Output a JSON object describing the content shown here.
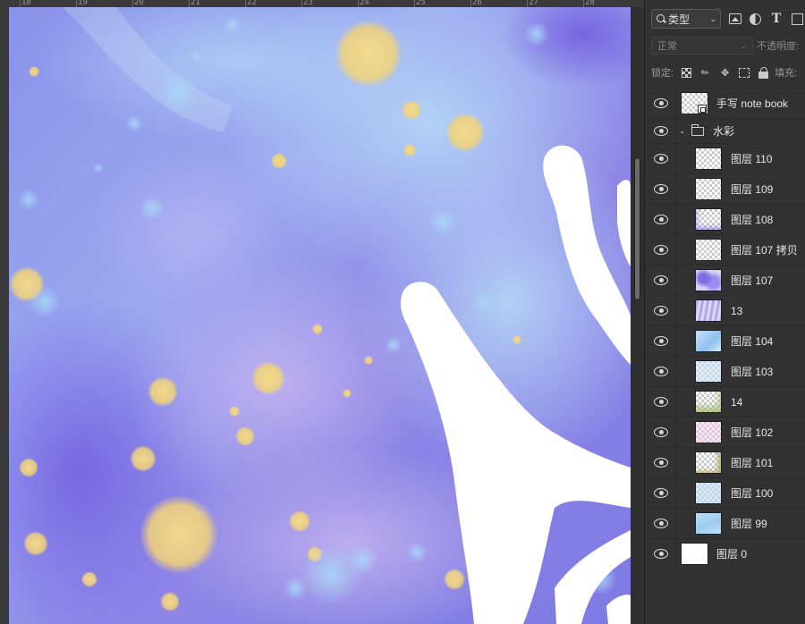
{
  "ruler": {
    "labels": [
      "18",
      "19",
      "20",
      "21",
      "22",
      "23",
      "24",
      "25",
      "26",
      "27",
      "28"
    ]
  },
  "layers_panel": {
    "filter": {
      "kind_label": "类型",
      "icons": [
        "image-filter-icon",
        "adjustment-filter-icon",
        "type-filter-icon",
        "shape-filter-icon"
      ]
    },
    "blend_mode": "正常",
    "opacity_label": "不透明度:",
    "lock_label": "锁定:",
    "fill_label": "填充:",
    "layers": [
      {
        "name": "手写 note book",
        "type": "smart-object",
        "visible": true
      },
      {
        "name": "水彩",
        "type": "group",
        "expanded": true,
        "visible": true
      },
      {
        "name": "图层 110",
        "type": "layer",
        "visible": true,
        "thumb": "transparent"
      },
      {
        "name": "图层 109",
        "type": "layer",
        "visible": true,
        "thumb": "transparent"
      },
      {
        "name": "图层 108",
        "type": "layer",
        "visible": true,
        "thumb": "speck-purple"
      },
      {
        "name": "图层 107 拷贝",
        "type": "layer",
        "visible": true,
        "thumb": "transparent"
      },
      {
        "name": "图层 107",
        "type": "layer",
        "visible": true,
        "thumb": "purple-splash"
      },
      {
        "name": "13",
        "type": "layer",
        "visible": true,
        "thumb": "lavender-strokes"
      },
      {
        "name": "图层 104",
        "type": "layer",
        "visible": true,
        "thumb": "blue-wash"
      },
      {
        "name": "图层 103",
        "type": "layer",
        "visible": true,
        "thumb": "light-blue"
      },
      {
        "name": "14",
        "type": "layer",
        "visible": true,
        "thumb": "green-wash"
      },
      {
        "name": "图层 102",
        "type": "layer",
        "visible": true,
        "thumb": "pink-dots"
      },
      {
        "name": "图层 101",
        "type": "layer",
        "visible": true,
        "thumb": "olive-edge"
      },
      {
        "name": "图层 100",
        "type": "layer",
        "visible": true,
        "thumb": "pale-blue"
      },
      {
        "name": "图层 99",
        "type": "layer",
        "visible": true,
        "thumb": "sky-blue"
      },
      {
        "name": "图层 0",
        "type": "background",
        "visible": true,
        "thumb": "white"
      }
    ]
  },
  "colors": {
    "panel_bg": "#323232",
    "canvas_violet": "#8f82e6",
    "canvas_blue": "#a6c6f0",
    "bokeh_yellow": "#f3d57a"
  }
}
